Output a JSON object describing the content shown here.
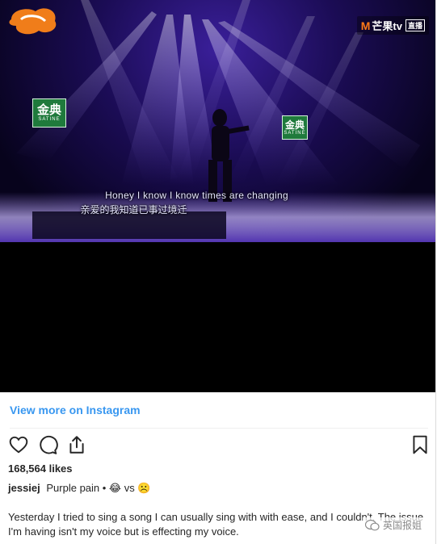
{
  "video": {
    "channel_badge": {
      "brand": "芒果tv",
      "tag": "直播"
    },
    "sponsor_left": {
      "zh": "金典",
      "en": "SATINE"
    },
    "sponsor_right": {
      "zh": "金典",
      "en": "SATINE"
    },
    "subtitle_en": "Honey I know I know times are changing",
    "subtitle_zh": "亲爱的我知道已事过境迁"
  },
  "link": {
    "view_more": "View more on Instagram"
  },
  "actions": {
    "like_icon": "heart-icon",
    "comment_icon": "comment-icon",
    "share_icon": "share-icon",
    "save_icon": "bookmark-icon"
  },
  "post": {
    "likes": "168,564 likes",
    "username": "jessiej",
    "caption": "Purple pain • 😂 vs ☹️",
    "body": "Yesterday I tried to sing a song I can usually sing with with ease, and I couldn't. The issue I'm having isn't my voice but is effecting my voice."
  },
  "watermark": {
    "label": "英国报姐"
  },
  "colors": {
    "link": "#3897f0",
    "stage_purple": "#2a1780",
    "sponsor_green": "#1f7a3c"
  }
}
